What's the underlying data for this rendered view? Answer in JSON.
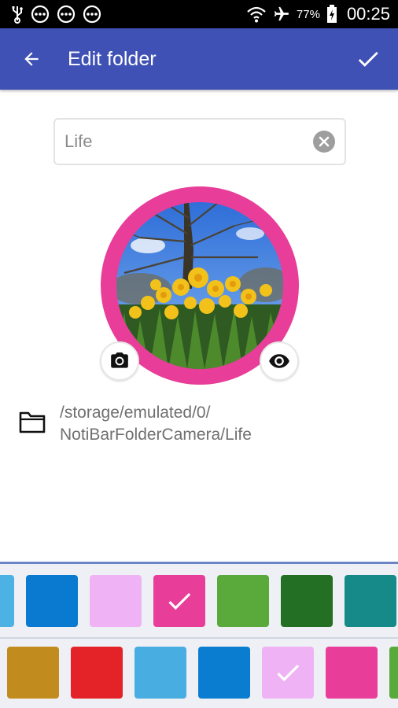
{
  "status_bar": {
    "battery_percent": "77%",
    "time": "00:25",
    "icons": [
      "usb-icon",
      "notification-dots-icon",
      "notification-dots-icon",
      "notification-dots-icon",
      "wifi-icon",
      "airplane-icon",
      "battery-charging-icon"
    ]
  },
  "app_bar": {
    "title": "Edit folder",
    "back_icon": "arrow-back-icon",
    "confirm_icon": "check-icon",
    "color": "#3f51b5"
  },
  "name_field": {
    "value": "Life",
    "clear_icon": "clear-circle-icon"
  },
  "avatar": {
    "ring_color": "#e83e99",
    "photo_subject": "daffodils-under-tree",
    "camera_icon": "camera-icon",
    "preview_icon": "eye-icon"
  },
  "folder_path": {
    "icon": "folder-icon",
    "line1": "/storage/emulated/0/",
    "line2": "NotiBarFolderCamera/Life"
  },
  "palette": {
    "row1": [
      {
        "color": "#4cb1e3",
        "selected": false
      },
      {
        "color": "#0a7ad0",
        "selected": false
      },
      {
        "color": "#efb3f5",
        "selected": false
      },
      {
        "color": "#e83e99",
        "selected": true
      },
      {
        "color": "#5aaa3b",
        "selected": false
      },
      {
        "color": "#236f24",
        "selected": false
      },
      {
        "color": "#158a88",
        "selected": false
      }
    ],
    "row2": [
      {
        "color": "#c18b1e",
        "selected": false
      },
      {
        "color": "#e32327",
        "selected": false
      },
      {
        "color": "#48ade0",
        "selected": false
      },
      {
        "color": "#0b7dd1",
        "selected": false
      },
      {
        "color": "#efb3f5",
        "selected": true
      },
      {
        "color": "#e83e99",
        "selected": false
      },
      {
        "color": "#5aaa3b",
        "selected": false
      }
    ],
    "check_icon": "check-icon"
  }
}
